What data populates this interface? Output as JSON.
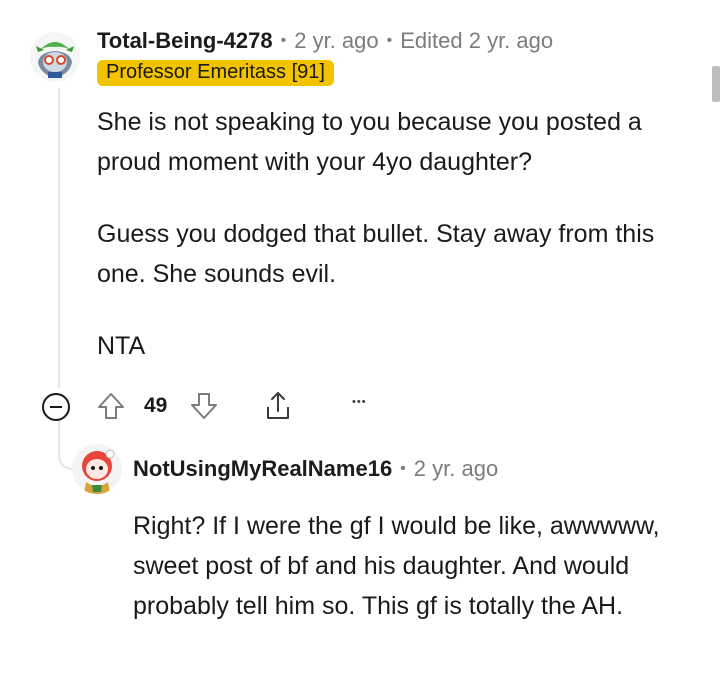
{
  "comment": {
    "username": "Total-Being-4278",
    "age": "2 yr. ago",
    "edited": "Edited 2 yr. ago",
    "flair": "Professor Emeritass [91]",
    "paragraphs": [
      "She is not speaking to you because you posted a proud moment with your 4yo daughter?",
      "Guess you dodged that bullet. Stay away from this one. She sounds evil.",
      "NTA"
    ],
    "votes": "49",
    "separator": "•",
    "more": "•••"
  },
  "reply": {
    "username": "NotUsingMyRealName16",
    "age": "2 yr. ago",
    "separator": "•",
    "text": "Right? If I were the gf I would be like, awwwww, sweet post of bf and his daughter. And would probably tell him so. This gf is totally the AH."
  },
  "colors": {
    "flair_bg": "#f2c400",
    "meta_gray": "#7c7c7c",
    "thread_line": "#e6e6e6"
  },
  "icons": [
    "collapse-icon",
    "upvote-icon",
    "downvote-icon",
    "share-icon",
    "more-options-icon"
  ]
}
